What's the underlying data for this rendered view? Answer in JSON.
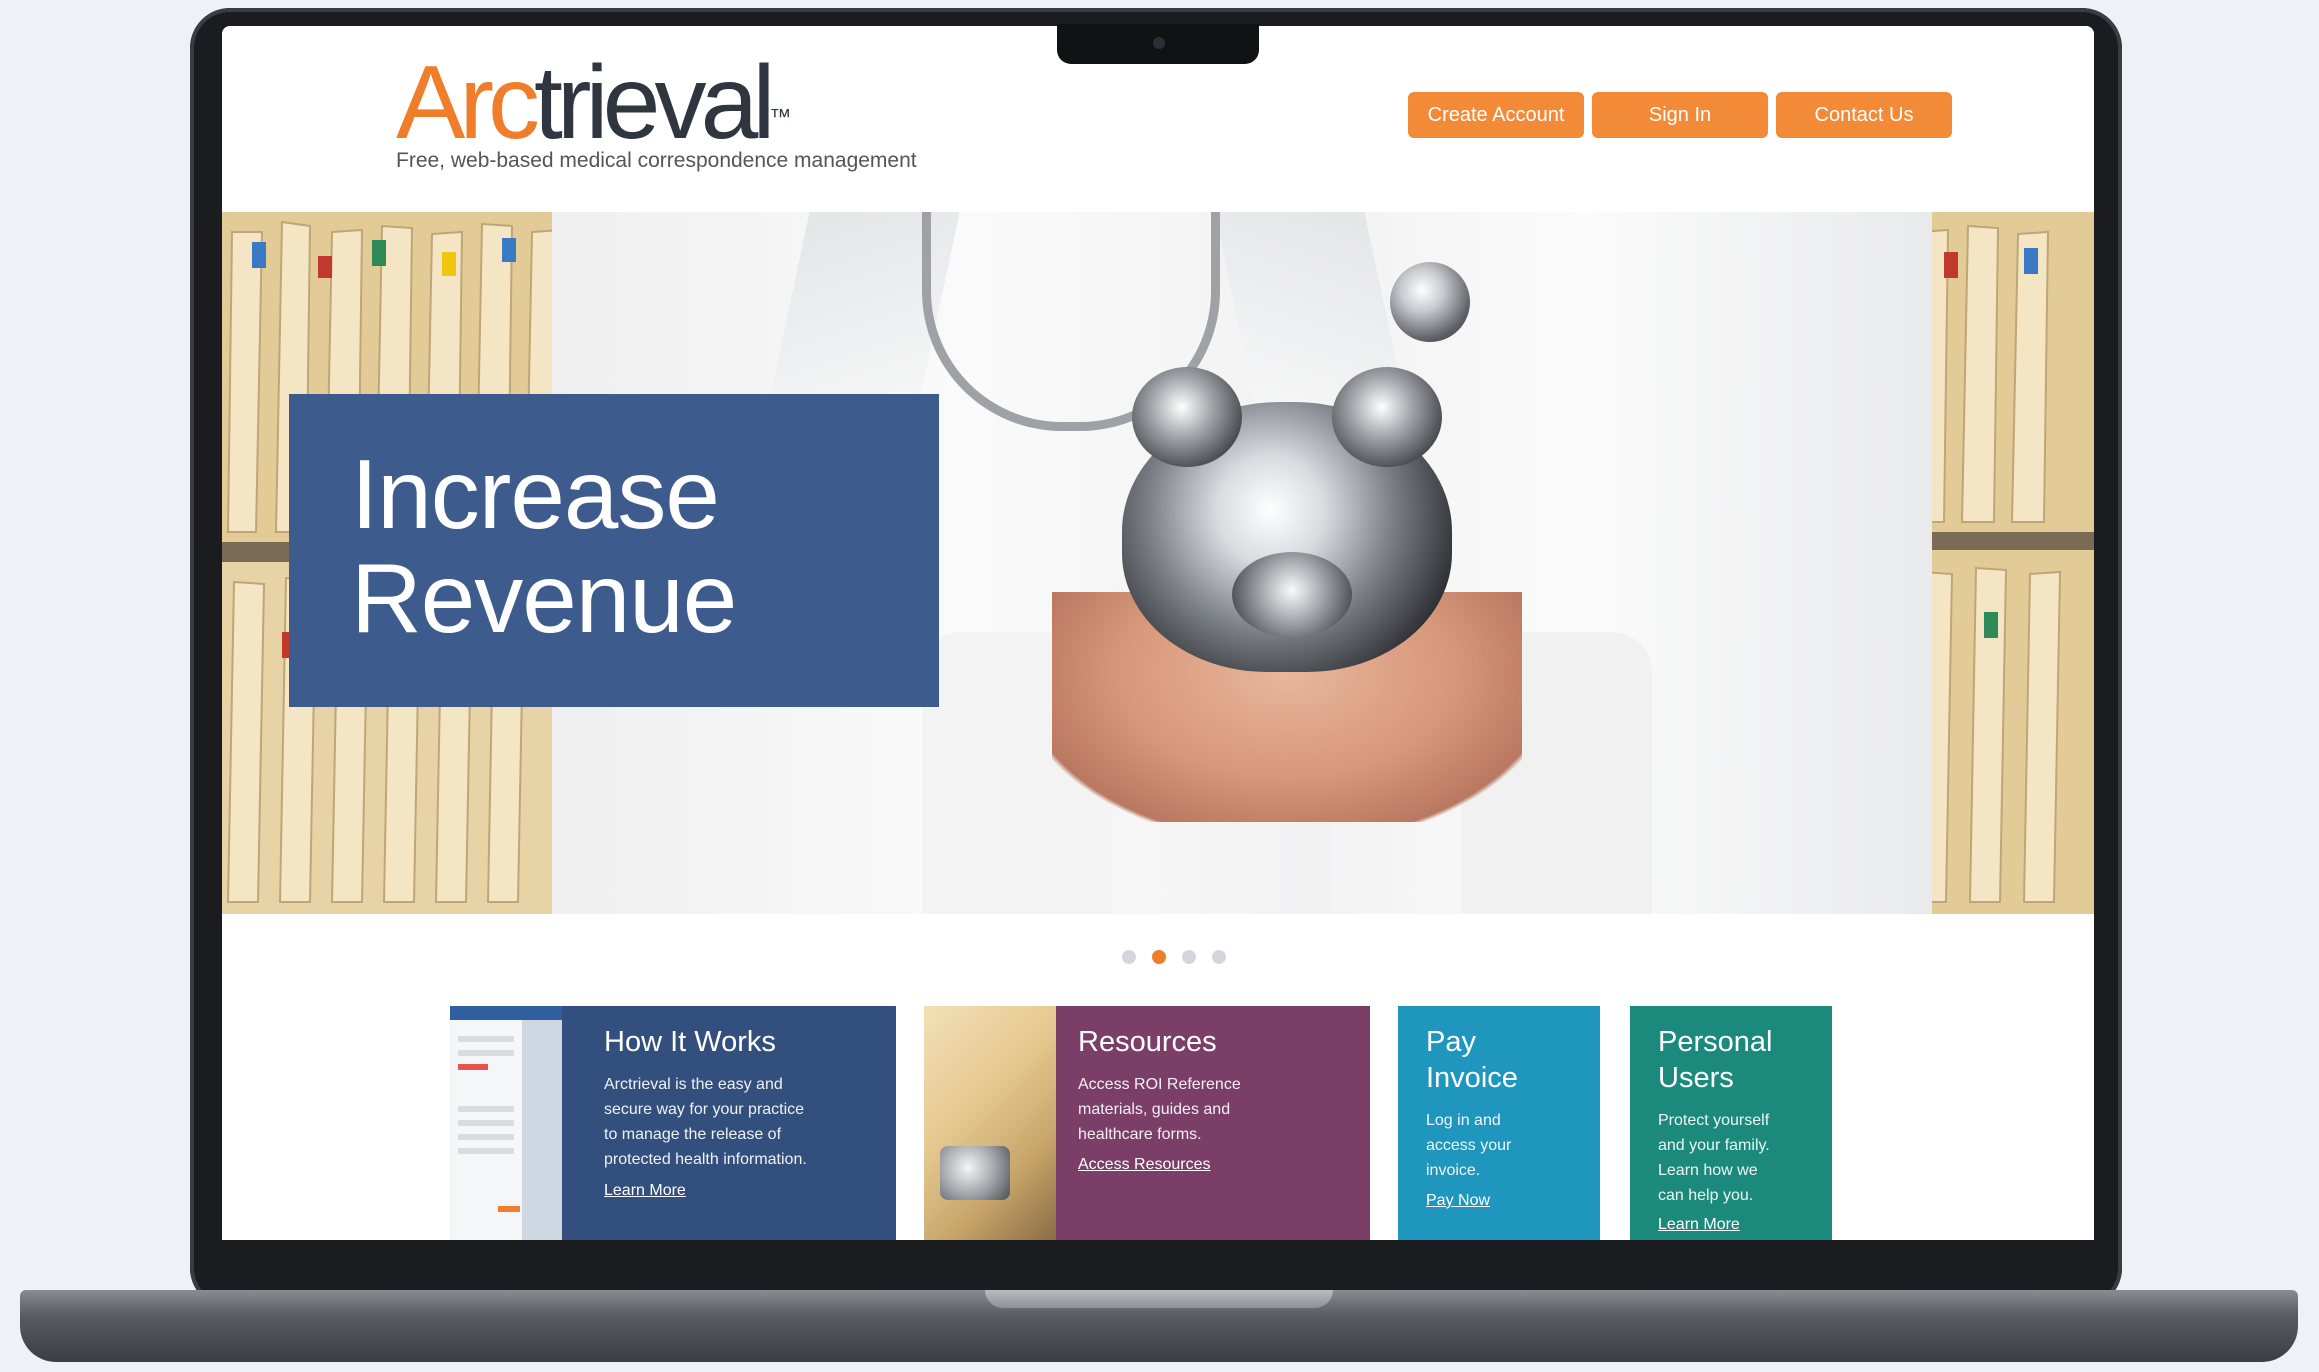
{
  "header": {
    "logo": {
      "arc": "Arc",
      "trieval": "trieval",
      "tm": "™"
    },
    "tagline": "Free, web-based medical correspondence management",
    "nav": [
      {
        "label": "Create Account"
      },
      {
        "label": "Sign In"
      },
      {
        "label": "Contact Us"
      }
    ]
  },
  "hero": {
    "caption": "Increase\nRevenue"
  },
  "carousel": {
    "slide_count": 4,
    "active_index": 1
  },
  "cards": {
    "how": {
      "title": "How It Works",
      "body": "Arctrieval is the easy and\nsecure way for your practice\nto manage the release of\nprotected health information.",
      "link": "Learn More"
    },
    "resources": {
      "title": "Resources",
      "body": "Access ROI Reference\nmaterials, guides and\nhealthcare forms.",
      "link": "Access Resources"
    },
    "pay": {
      "title": "Pay\nInvoice",
      "body": "Log in and\naccess your\ninvoice.",
      "link": "Pay Now"
    },
    "personal": {
      "title": "Personal\nUsers",
      "body": "Protect yourself\nand your family.\nLearn how we\ncan help you.",
      "link": "Learn More"
    }
  },
  "colors": {
    "brand_orange": "#f07d2a",
    "hero_caption_bg": "#3d5b8c",
    "how_card": "#334f7d",
    "resources_card": "#7b3e68",
    "pay_card": "#1f96bd",
    "personal_card": "#1b8a7d"
  }
}
